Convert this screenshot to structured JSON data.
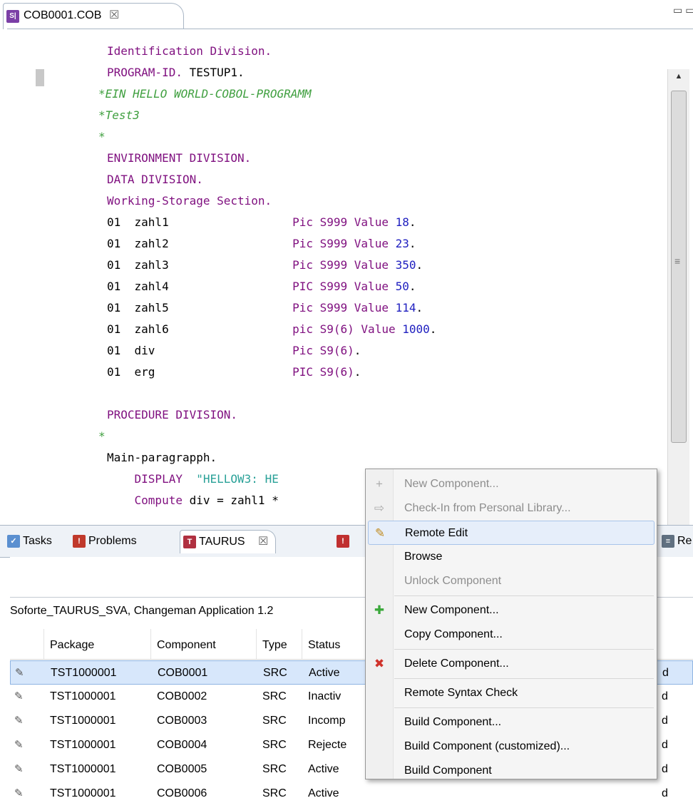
{
  "editor": {
    "tab_title": "COB0001.COB",
    "tab_close_glyph": "☒",
    "view_controls": "▭▭",
    "tab_icon_text": "S|",
    "lines": [
      [
        {
          "t": "Identification Division.",
          "c": "kw"
        }
      ],
      [
        {
          "t": "PROGRAM-ID. ",
          "c": "kw"
        },
        {
          "t": "TESTUP1.",
          "c": "nm"
        }
      ],
      [
        {
          "t": "*EIN HELLO WORLD-COBOL-PROGRAMM",
          "c": "cm"
        }
      ],
      [
        {
          "t": "*Test3",
          "c": "cm"
        }
      ],
      [
        {
          "t": "*",
          "c": "cm"
        }
      ],
      [
        {
          "t": "ENVIRONMENT DIVISION.",
          "c": "kw"
        }
      ],
      [
        {
          "t": "DATA DIVISION.",
          "c": "kw"
        }
      ],
      [
        {
          "t": "Working-Storage Section.",
          "c": "kw"
        }
      ],
      [
        {
          "t": "01  zahl1                  ",
          "c": "nm"
        },
        {
          "t": "Pic S999 Value ",
          "c": "ty"
        },
        {
          "t": "18",
          "c": "num"
        },
        {
          "t": ".",
          "c": "nm"
        }
      ],
      [
        {
          "t": "01  zahl2                  ",
          "c": "nm"
        },
        {
          "t": "Pic S999 Value ",
          "c": "ty"
        },
        {
          "t": "23",
          "c": "num"
        },
        {
          "t": ".",
          "c": "nm"
        }
      ],
      [
        {
          "t": "01  zahl3                  ",
          "c": "nm"
        },
        {
          "t": "Pic S999 Value ",
          "c": "ty"
        },
        {
          "t": "350",
          "c": "num"
        },
        {
          "t": ".",
          "c": "nm"
        }
      ],
      [
        {
          "t": "01  zahl4                  ",
          "c": "nm"
        },
        {
          "t": "PIC S999 Value ",
          "c": "ty"
        },
        {
          "t": "50",
          "c": "num"
        },
        {
          "t": ".",
          "c": "nm"
        }
      ],
      [
        {
          "t": "01  zahl5                  ",
          "c": "nm"
        },
        {
          "t": "Pic S999 Value ",
          "c": "ty"
        },
        {
          "t": "114",
          "c": "num"
        },
        {
          "t": ".",
          "c": "nm"
        }
      ],
      [
        {
          "t": "01  zahl6                  ",
          "c": "nm"
        },
        {
          "t": "pic S9(6) Value ",
          "c": "ty"
        },
        {
          "t": "1000",
          "c": "num"
        },
        {
          "t": ".",
          "c": "nm"
        }
      ],
      [
        {
          "t": "01  div                    ",
          "c": "nm"
        },
        {
          "t": "Pic S9(6)",
          "c": "ty"
        },
        {
          "t": ".",
          "c": "nm"
        }
      ],
      [
        {
          "t": "01  erg                    ",
          "c": "nm"
        },
        {
          "t": "PIC S9(6)",
          "c": "ty"
        },
        {
          "t": ".",
          "c": "nm"
        }
      ],
      [
        {
          "t": "",
          "c": "nm"
        }
      ],
      [
        {
          "t": "PROCEDURE DIVISION.",
          "c": "kw"
        }
      ],
      [
        {
          "t": "*",
          "c": "cm"
        }
      ],
      [
        {
          "t": "Main-paragrapph.",
          "c": "nm"
        }
      ],
      [
        {
          "t": "    DISPLAY  ",
          "c": "kw"
        },
        {
          "t": "\"HELLOW3: HE",
          "c": "str"
        }
      ],
      [
        {
          "t": "    Compute ",
          "c": "kw"
        },
        {
          "t": "div = zahl1 *",
          "c": "nm"
        }
      ]
    ]
  },
  "view_tabs": [
    {
      "label": "Tasks",
      "icon": "tasks-icon",
      "color": "#5a8fd0",
      "glyph": "✓"
    },
    {
      "label": "Problems",
      "icon": "problems-icon",
      "color": "#c0392b",
      "glyph": "!"
    },
    {
      "label": "TAURUS",
      "icon": "taurus-icon",
      "color": "#c0392b",
      "glyph": "T"
    },
    {
      "label": "☒",
      "icon": "close-icon"
    },
    {
      "label": "Re",
      "icon": "console-icon",
      "color": "#607080",
      "glyph": "≡"
    }
  ],
  "view": {
    "title": "Soforte_TAURUS_SVA, Changeman Application 1.2"
  },
  "table": {
    "columns": [
      "Package",
      "Component",
      "Type",
      "Status"
    ],
    "rows": [
      {
        "package": "TST1000001",
        "component": "COB0001",
        "type": "SRC",
        "status": "Active",
        "tail": "d"
      },
      {
        "package": "TST1000001",
        "component": "COB0002",
        "type": "SRC",
        "status": "Inactiv",
        "tail": "d"
      },
      {
        "package": "TST1000001",
        "component": "COB0003",
        "type": "SRC",
        "status": "Incomp",
        "tail": "d"
      },
      {
        "package": "TST1000001",
        "component": "COB0004",
        "type": "SRC",
        "status": "Rejecte",
        "tail": "d"
      },
      {
        "package": "TST1000001",
        "component": "COB0005",
        "type": "SRC",
        "status": "Active",
        "tail": "d"
      },
      {
        "package": "TST1000001",
        "component": "COB0006",
        "type": "SRC",
        "status": "Active",
        "tail": "d"
      }
    ]
  },
  "context_menu": {
    "items": [
      {
        "label": "New Component...",
        "enabled": false,
        "icon": "plus-icon",
        "glyph": "+",
        "color": "#aaaaaa"
      },
      {
        "label": "Check-In from Personal Library...",
        "enabled": false,
        "icon": "check-in-icon",
        "glyph": "⇨",
        "color": "#aaaaaa"
      },
      {
        "label": "Remote Edit",
        "enabled": true,
        "hover": true,
        "icon": "pencil-icon",
        "glyph": "✎",
        "color": "#c08a1e"
      },
      {
        "label": "Browse",
        "enabled": true
      },
      {
        "label": "Unlock Component",
        "enabled": false
      },
      {
        "sep": true
      },
      {
        "label": "New Component...",
        "enabled": true,
        "icon": "plus-icon",
        "glyph": "✚",
        "color": "#3aa83a"
      },
      {
        "label": "Copy Component...",
        "enabled": true
      },
      {
        "sep": true
      },
      {
        "label": "Delete Component...",
        "enabled": true,
        "icon": "delete-icon",
        "glyph": "✖",
        "color": "#d0332b"
      },
      {
        "sep": true
      },
      {
        "label": "Remote Syntax Check",
        "enabled": true
      },
      {
        "sep": true
      },
      {
        "label": "Build Component...",
        "enabled": true
      },
      {
        "label": "Build Component (customized)...",
        "enabled": true
      },
      {
        "label": "Build Component",
        "enabled": true
      }
    ]
  }
}
